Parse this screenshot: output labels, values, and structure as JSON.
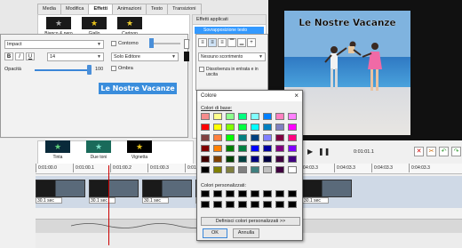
{
  "tabs": [
    "Media",
    "Modifica",
    "Effetti",
    "Animazioni",
    "Testo",
    "Transizioni"
  ],
  "active_tab": "Effetti",
  "transitions_top": [
    {
      "label": "Bianco & nero"
    },
    {
      "label": "Giallo"
    },
    {
      "label": "Cartoon"
    }
  ],
  "transitions_bottom": [
    {
      "label": "Tinta"
    },
    {
      "label": "Due toni"
    },
    {
      "label": "Vignetta"
    }
  ],
  "applied": {
    "header": "Effetti applicati",
    "selected": "Sovrapposizione testo"
  },
  "text_panel": {
    "font": "Impact",
    "size": "14",
    "bold": "B",
    "italic": "I",
    "underline": "U",
    "opacity_label": "Opacità",
    "opacity_value": "100",
    "opacity_level": 1.0,
    "stroke_label": "Contorno",
    "mode": "Solo Editore",
    "shadow_label": "Ombra",
    "sample_text": "Le Nostre Vacanze"
  },
  "options": {
    "scroll": "Nessuno scorrimento",
    "fade": "Dissolvenza in entrata e in uscita"
  },
  "video": {
    "title": "Le Nostre Vacanze"
  },
  "transport": {
    "time": "0:01:01.1"
  },
  "ruler": [
    "0:01:00.0",
    "0:01:00.1",
    "0:01:00.2",
    "0:01:00.3",
    "0:01:00.4",
    "0:01:00.5",
    "0:04:00.3",
    "0:04:03.3",
    "0:04:03.3",
    "0:04:03.3",
    "0:04:03.3"
  ],
  "clips": [
    "30.1 sec",
    "30.1 sec",
    "30.1 sec",
    "30.1 sec",
    "30.1 sec",
    "30.1 sec"
  ],
  "color_dialog": {
    "title": "Colore",
    "close": "×",
    "basic_label": "Colori di base:",
    "basic_colors": [
      "#f58c8c",
      "#ffff8c",
      "#8cff8c",
      "#00ff80",
      "#80ffff",
      "#0080ff",
      "#ff80c0",
      "#ff80ff",
      "#ff0000",
      "#ffff00",
      "#80ff00",
      "#00ff40",
      "#00ffff",
      "#0080c0",
      "#8080c0",
      "#ff00ff",
      "#804040",
      "#ff8040",
      "#00ff00",
      "#008080",
      "#004080",
      "#8080ff",
      "#800040",
      "#ff0080",
      "#800000",
      "#ff8000",
      "#008000",
      "#008040",
      "#0000ff",
      "#0000a0",
      "#800080",
      "#8000ff",
      "#400000",
      "#804000",
      "#004000",
      "#004040",
      "#000080",
      "#000040",
      "#400040",
      "#400080",
      "#000000",
      "#808000",
      "#808040",
      "#808080",
      "#408080",
      "#c0c0c0",
      "#400040",
      "#ffffff"
    ],
    "custom_label": "Colori personalizzati:",
    "custom_colors": [
      "#000000",
      "#000000",
      "#000000",
      "#000000",
      "#000000",
      "#000000",
      "#000000",
      "#000000",
      "#000000",
      "#000000",
      "#000000",
      "#000000",
      "#000000",
      "#000000",
      "#000000",
      "#000000"
    ],
    "define_button": "Definisci colori personalizzati >>",
    "ok_button": "OK",
    "cancel_button": "Annulla"
  }
}
